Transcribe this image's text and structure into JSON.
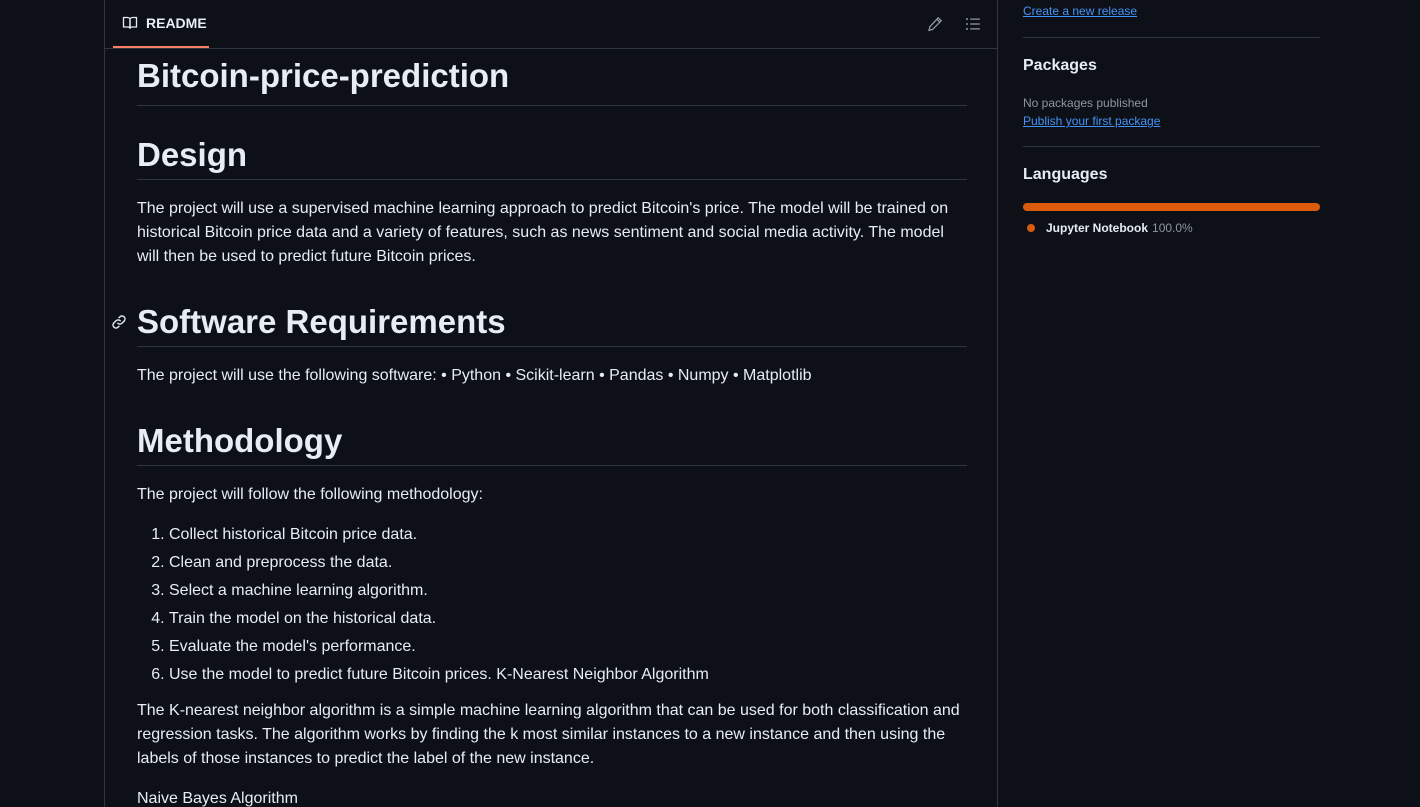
{
  "readme": {
    "tab_label": "README",
    "title": "Bitcoin-price-prediction",
    "sections": {
      "design_heading": "Design",
      "design_text": "The project will use a supervised machine learning approach to predict Bitcoin's price. The model will be trained on historical Bitcoin price data and a variety of features, such as news sentiment and social media activity. The model will then be used to predict future Bitcoin prices.",
      "software_heading": "Software Requirements",
      "software_text": "The project will use the following software: • Python • Scikit-learn • Pandas • Numpy • Matplotlib",
      "method_heading": "Methodology",
      "method_intro": "The project will follow the following methodology:",
      "method_steps": [
        "Collect historical Bitcoin price data.",
        "Clean and preprocess the data.",
        "Select a machine learning algorithm.",
        "Train the model on the historical data.",
        "Evaluate the model's performance.",
        "Use the model to predict future Bitcoin prices. K-Nearest Neighbor Algorithm"
      ],
      "knn_text": "The K-nearest neighbor algorithm is a simple machine learning algorithm that can be used for both classification and regression tasks. The algorithm works by finding the k most similar instances to a new instance and then using the labels of those instances to predict the label of the new instance.",
      "nb_text": "Naive Bayes Algorithm"
    },
    "icons": {
      "tab": "book-icon",
      "edit": "pencil-icon",
      "outline": "list-unordered-icon",
      "anchor": "link-icon"
    }
  },
  "sidebar": {
    "releases_link": "Create a new release",
    "packages": {
      "heading": "Packages",
      "empty_text": "No packages published",
      "link": "Publish your first package"
    },
    "languages": {
      "heading": "Languages",
      "items": [
        {
          "name": "Jupyter Notebook",
          "percent": "100.0%",
          "share": 100,
          "color": "#DA5B0B"
        }
      ]
    }
  },
  "colors": {
    "background": "#0d1117",
    "border": "#30363d",
    "accent_tab": "#f78166",
    "link": "#4493f8",
    "muted": "#8d96a0"
  }
}
